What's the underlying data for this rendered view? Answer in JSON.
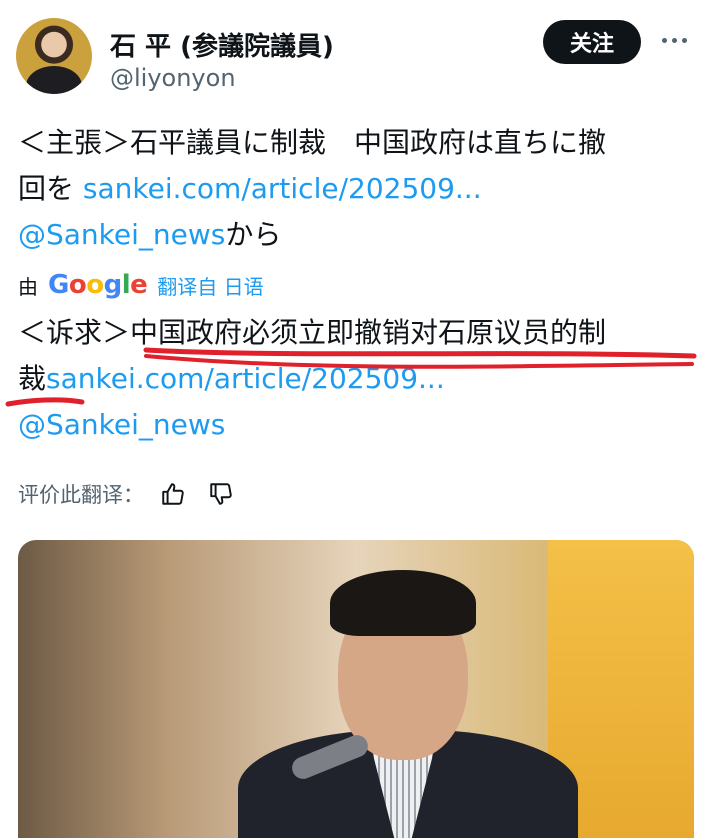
{
  "author": {
    "name": "石 平 (参議院議員)",
    "handle": "@liyonyon",
    "follow_label": "关注"
  },
  "tweet": {
    "line1": "＜主張＞石平議員に制裁　中国政府は直ちに撤",
    "line2_prefix": "回を ",
    "link1": "sankei.com/article/202509...",
    "mention1": "@Sankei_news",
    "mention1_suffix": "から"
  },
  "translation_bar": {
    "by": "由",
    "google": [
      "G",
      "o",
      "o",
      "g",
      "l",
      "e"
    ],
    "translated_from": "翻译自 日语"
  },
  "translated": {
    "line1_prefix": "＜诉求＞",
    "line1_main": "中国政府必须立即撤销对石原议员的制",
    "line2_prefix": "裁",
    "link2": "sankei.com/article/202509...",
    "mention2": "@Sankei_news"
  },
  "rating": {
    "label": "评价此翻译："
  },
  "colors": {
    "link": "#1d9bf0",
    "underline": "#e0202a",
    "follow_bg": "#0f1419"
  }
}
